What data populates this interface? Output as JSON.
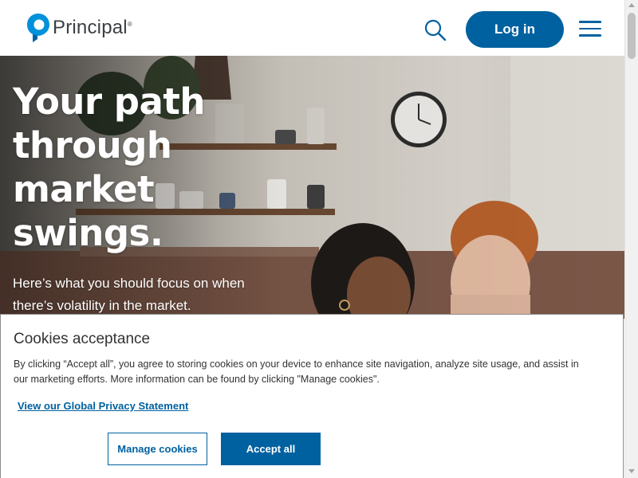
{
  "header": {
    "logo_text": "Principal",
    "logo_reg": "®",
    "login_label": "Log in",
    "icons": [
      "principal-logo-icon",
      "search-icon",
      "hamburger-menu-icon"
    ]
  },
  "hero": {
    "title": "Your path through market swings.",
    "subtitle": "Here’s what you should focus on when there’s volatility in the market."
  },
  "cookie_banner": {
    "title": "Cookies acceptance",
    "body": "By clicking “Accept all”, you agree to storing cookies on your device to enhance site navigation, analyze site usage, and assist in our marketing efforts. More information can be found by clicking \"Manage cookies\".",
    "privacy_link": "View our Global Privacy Statement",
    "manage_label": "Manage cookies",
    "accept_label": "Accept all"
  },
  "colors": {
    "brand_blue": "#0061a0",
    "logo_blue": "#0091da",
    "text_dark": "#333333"
  }
}
